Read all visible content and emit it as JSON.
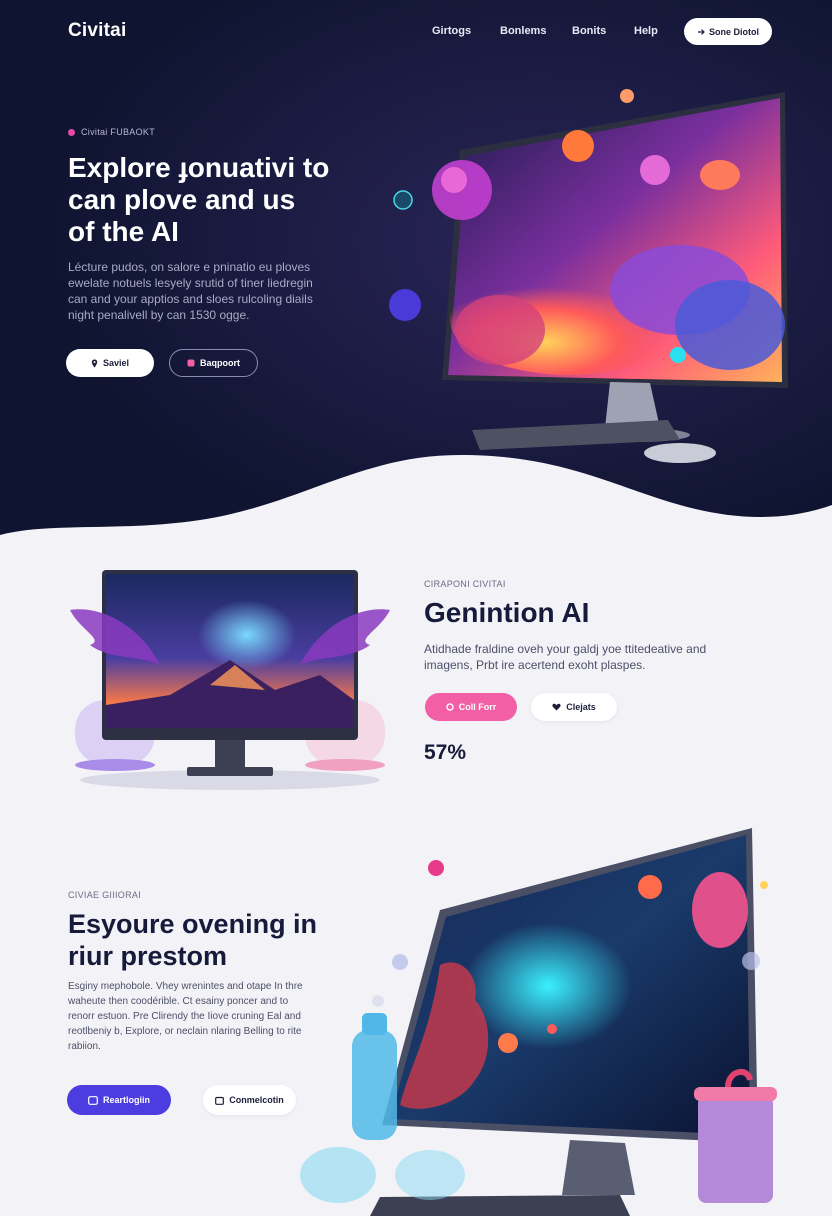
{
  "nav": {
    "logo": "Civitai",
    "links": [
      "Girtogs",
      "Bonlems",
      "Bonits",
      "Help"
    ],
    "cta_label": "Sone Diotol"
  },
  "hero": {
    "eyebrow": "Civitai FUBAOKT",
    "title_lines": [
      "Explore ɟonuativi to",
      "can plove and us",
      "of the AI"
    ],
    "body_lines": [
      "Lécture pudos, on salore e pninatio eu ploves",
      "ewelate notuels lesyely srutid of tiner liedregin",
      "can and your apptios and sloes rulcoling diails",
      "night penalivell by can 1530 ogge."
    ],
    "primary_label": "Saviel",
    "secondary_label": "Baqpoort"
  },
  "section2": {
    "eyebrow": "CIRAPONI CIVITAI",
    "title": "Genintion AI",
    "body_lines": [
      "Atidhade fraldine oveh your galdj yoe ttitedeative and",
      "imagens, Prbt ire acertend exoht plaspes."
    ],
    "primary_label": "Coll Forr",
    "secondary_label": "Clejats",
    "stat": "57%"
  },
  "section3": {
    "eyebrow": "CIVIAE GIIIORAI",
    "title_lines": [
      "Esyoure ovening in",
      "riur prestom"
    ],
    "body_lines": [
      "Esginy mephobole. Vhey wrenintes and otape In thre",
      "waheute then coodérible. Ct esainy poncer and to",
      "renorr estuon. Pre Clirendy the Iiove cruning Eal and",
      "reotlbeniy b, Explore, or neclain nlaring Belling to rite",
      "rabiion."
    ],
    "primary_label": "Reartlogiin",
    "secondary_label": "Conmelcotin"
  },
  "colors": {
    "hero_bg": "#0f1430",
    "page_bg": "#f3f3f7",
    "accent_pink": "#f25fa4",
    "accent_violet": "#4b3de0"
  }
}
